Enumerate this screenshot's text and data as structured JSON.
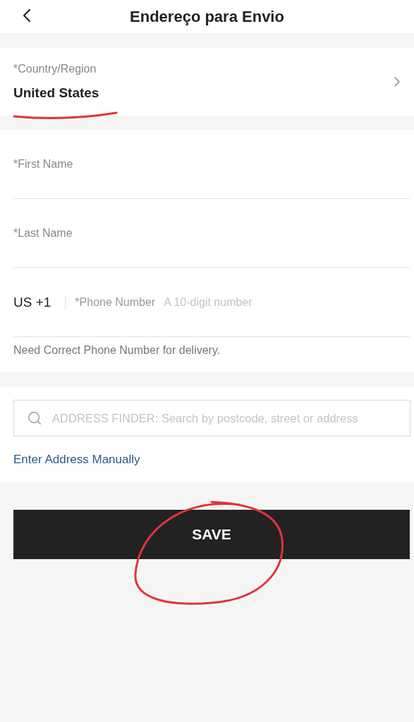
{
  "header": {
    "title": "Endereço para Envio"
  },
  "country": {
    "label": "*Country/Region",
    "value": "United States"
  },
  "fields": [
    {
      "kind": "text",
      "placeholder": "*First Name"
    },
    {
      "kind": "text",
      "placeholder": "*Last Name"
    },
    {
      "kind": "phone",
      "code": "US +1",
      "label": "*Phone Number",
      "placeholder": "A 10-digit number"
    }
  ],
  "phone_hint": "Need Correct Phone Number for delivery.",
  "address_finder": {
    "placeholder": "ADDRESS FINDER: Search by postcode, street or address"
  },
  "manual_link": "Enter Address Manually",
  "save_button": "SAVE"
}
